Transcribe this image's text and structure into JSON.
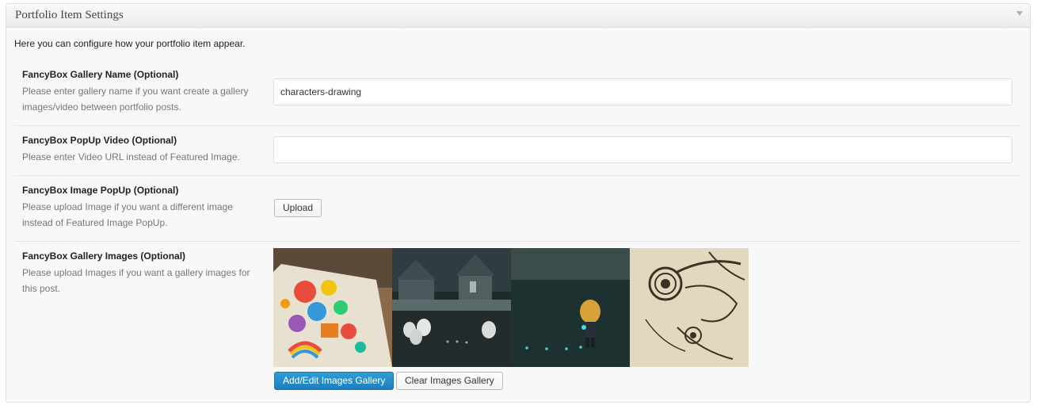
{
  "metabox": {
    "title": "Portfolio Item Settings",
    "toggle_icon": "triangle-down-icon",
    "intro": "Here you can configure how your portfolio item appear."
  },
  "fields": [
    {
      "label": "FancyBox Gallery Name (Optional)",
      "description": "Please enter gallery name if you want create a gallery images/video between portfolio posts.",
      "value": "characters-drawing"
    },
    {
      "label": "FancyBox PopUp Video (Optional)",
      "description": "Please enter Video URL instead of Featured Image.",
      "value": ""
    },
    {
      "label": "FancyBox Image PopUp (Optional)",
      "description": "Please upload Image if you want a different image instead of Featured Image PopUp.",
      "button": "Upload"
    },
    {
      "label": "FancyBox Gallery Images (Optional)",
      "description": "Please upload Images if you want a gallery images for this post.",
      "buttons": {
        "add_edit": "Add/Edit Images Gallery",
        "clear": "Clear Images Gallery"
      }
    }
  ],
  "colors": {
    "primary_button": "#1e7ec0",
    "panel_bg": "#f8f8f8"
  }
}
